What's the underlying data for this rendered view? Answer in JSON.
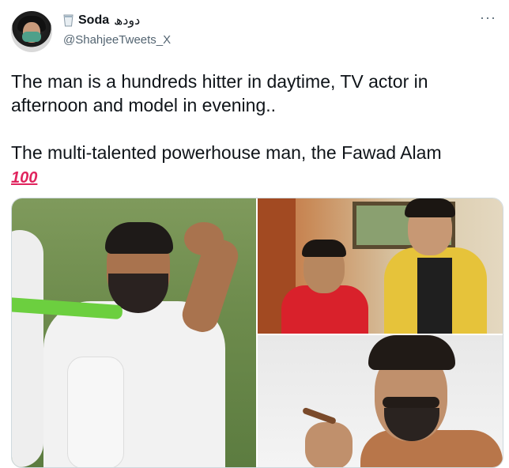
{
  "author": {
    "display_name": "Soda",
    "urdu_name": "دودھ",
    "handle": "@ShahjeeTweets_X",
    "badge_icon": "cup-icon"
  },
  "more_label": "···",
  "tweet": {
    "line1": "The man is a hundreds hitter in daytime, TV actor in afternoon and model in evening..",
    "line2": "The multi-talented powerhouse man, the Fawad Alam",
    "emoji": "100"
  },
  "colors": {
    "text": "#0f1419",
    "secondary": "#536471",
    "emoji_red": "#e0245e",
    "border": "#cfd9de"
  },
  "media": {
    "images": [
      {
        "name": "cricket-celebration-image"
      },
      {
        "name": "tv-drama-scene-image"
      },
      {
        "name": "model-portrait-image"
      }
    ]
  }
}
